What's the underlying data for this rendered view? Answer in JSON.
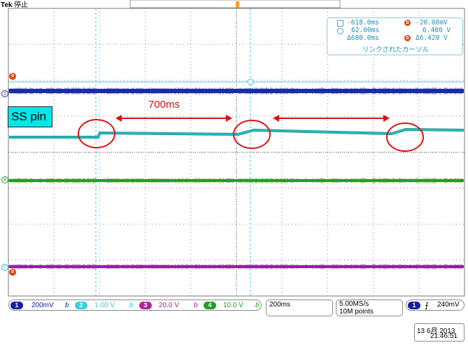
{
  "header": {
    "brand": "Tek",
    "state": "停止"
  },
  "label_box": {
    "text": "SS pin"
  },
  "annotation": {
    "interval": "700ms"
  },
  "cursor_readout": {
    "row1_left": "-618.0ms",
    "row1_right": "-20.00mV",
    "row2_left": "62.00ms",
    "row2_right": "6.400 V",
    "row3_left": "Δ680.0ms",
    "row3_right": "Δ6.420 V",
    "footer": "リンクされたカーソル",
    "icon_b": "b"
  },
  "channel_markers": {
    "ch1": "1",
    "ch4": "4",
    "ch2": "2",
    "ref_b": "b"
  },
  "channels": [
    {
      "num": "1",
      "value": "200mV",
      "bw": "b",
      "color": "#1020a0",
      "badge_bg": "#1020a0",
      "badge_fg": "#ffffff"
    },
    {
      "num": "2",
      "value": "1.00 V",
      "bw": "b",
      "color": "#38c8d8",
      "badge_bg": "#38d0e0",
      "badge_fg": "#ffffff"
    },
    {
      "num": "3",
      "value": "20.0 V",
      "bw": "b",
      "color": "#a02090",
      "badge_bg": "#b02898",
      "badge_fg": "#ffffff"
    },
    {
      "num": "4",
      "value": "10.0 V",
      "bw": "b",
      "color": "#20a020",
      "badge_bg": "#20a020",
      "badge_fg": "#ffffff"
    }
  ],
  "timebase": {
    "scale": "200ms",
    "sample_rate": "5.00MS/s",
    "record_length": "10M points"
  },
  "trigger": {
    "channel": "1",
    "slope_icon": "rising-edge-icon",
    "level": "240mV"
  },
  "datetime": {
    "date": "13 6月  2013",
    "time": "21:46:51"
  },
  "colors": {
    "ch1": "#1a2aa8",
    "ch2": "#20b8c0",
    "ch3": "#9020a0",
    "ch4": "#20a020",
    "grid": "#888888",
    "annotation_red": "#e01010",
    "cursor": "#40c8e0"
  }
}
